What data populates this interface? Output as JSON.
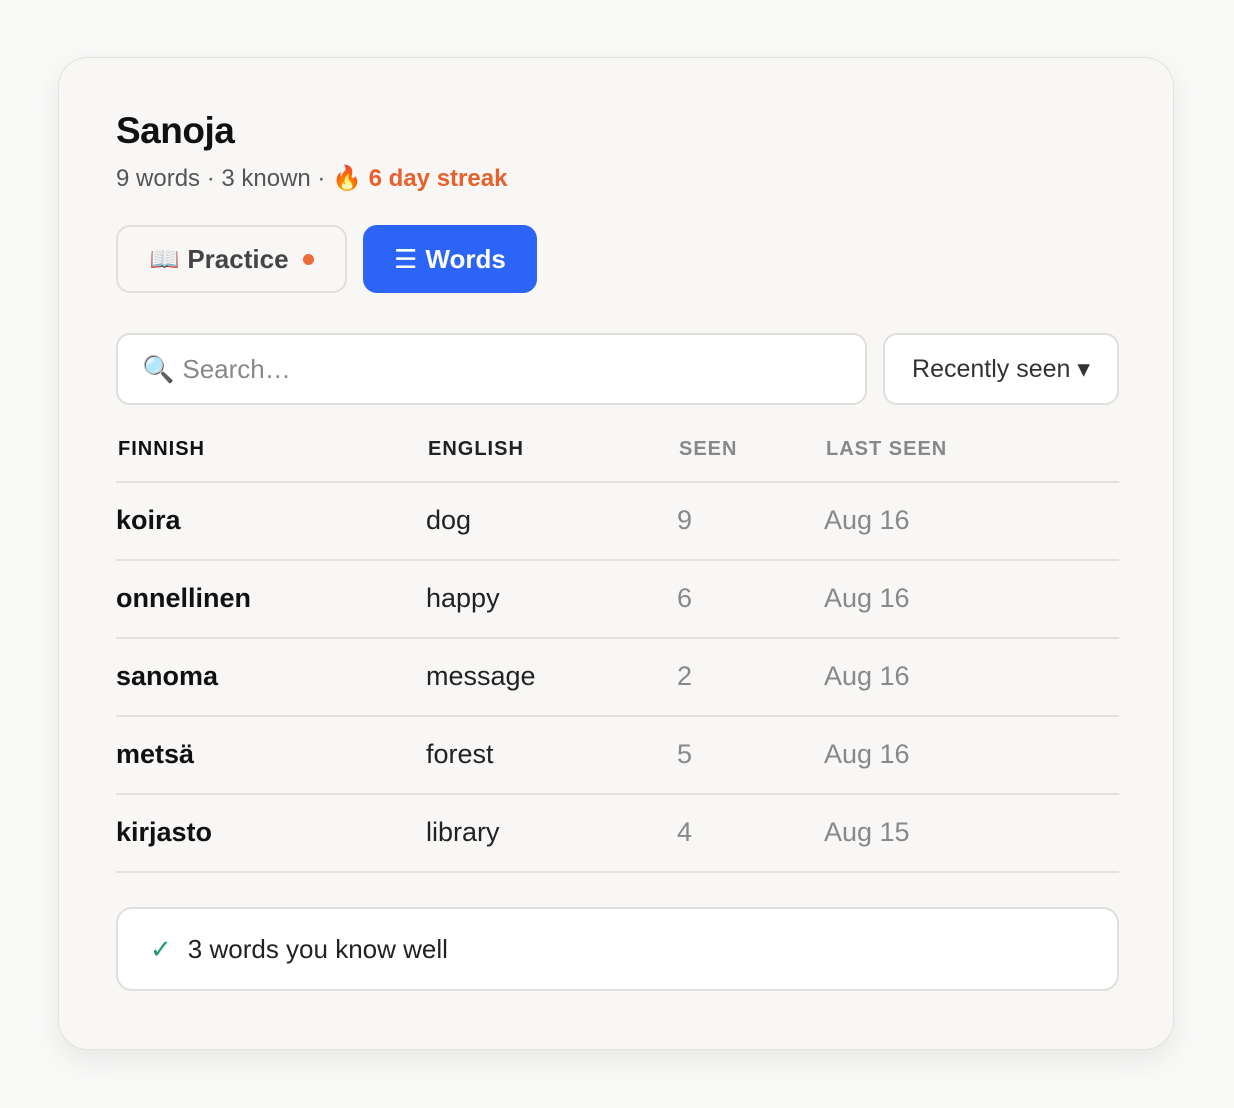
{
  "app": {
    "title": "Sanoja",
    "stats": {
      "words": "9 words",
      "sep1": " · ",
      "known": "3 known",
      "sep2": " · ",
      "streak": "6 day streak"
    }
  },
  "tabs": {
    "practice_label": "Practice",
    "words_label": "Words",
    "active": "words"
  },
  "search": {
    "placeholder": "Search…",
    "value": ""
  },
  "sort": {
    "selected": "Recently seen"
  },
  "table": {
    "headers": [
      "FINNISH",
      "ENGLISH",
      "SEEN",
      "LAST SEEN"
    ],
    "rows": [
      {
        "finnish": "koira",
        "english": "dog",
        "seen": "9",
        "last_seen": "Aug 16"
      },
      {
        "finnish": "onnellinen",
        "english": "happy",
        "seen": "6",
        "last_seen": "Aug 16"
      },
      {
        "finnish": "sanoma",
        "english": "message",
        "seen": "2",
        "last_seen": "Aug 16"
      },
      {
        "finnish": "metsä",
        "english": "forest",
        "seen": "5",
        "last_seen": "Aug 16"
      },
      {
        "finnish": "kirjasto",
        "english": "library",
        "seen": "4",
        "last_seen": "Aug 15"
      }
    ]
  },
  "known_section": {
    "label": "3 words you know well"
  },
  "icons": {
    "fire": "fire-icon",
    "book": "book-icon",
    "menu": "menu-icon",
    "search": "search-icon",
    "chevron": "chevron-down-icon",
    "check": "check-icon"
  },
  "colors": {
    "accent": "#2b64f6",
    "streak": "#e8612c",
    "notification_dot": "#ee6b3b",
    "check": "#1f9d6b"
  }
}
